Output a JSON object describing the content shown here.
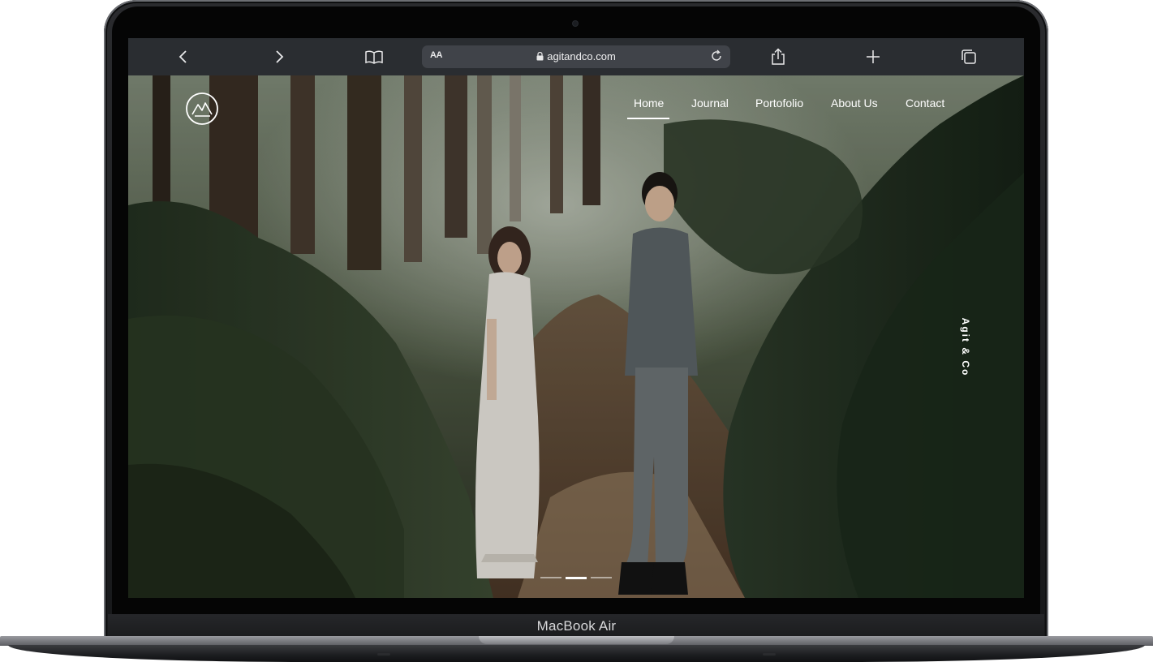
{
  "device": {
    "model_label": "MacBook Air"
  },
  "browser": {
    "text_size_label": "AA",
    "url": "agitandco.com",
    "icons": {
      "back": "chevron-left-icon",
      "forward": "chevron-right-icon",
      "bookmarks": "book-icon",
      "lock": "lock-icon",
      "reload": "reload-icon",
      "share": "share-icon",
      "new_tab": "plus-icon",
      "tabs": "tabs-icon"
    }
  },
  "site": {
    "logo": "mountain-logo-icon",
    "nav": [
      {
        "label": "Home",
        "active": true
      },
      {
        "label": "Journal",
        "active": false
      },
      {
        "label": "Portofolio",
        "active": false
      },
      {
        "label": "About Us",
        "active": false
      },
      {
        "label": "Contact",
        "active": false
      }
    ],
    "vertical_brand": "Agit & Co",
    "slider": {
      "slides": 3,
      "active_index": 1
    },
    "hero_image": "couple-in-forest-path-photo"
  },
  "colors": {
    "toolbar_bg": "#2a2d31",
    "address_bg": "#404349",
    "nav_text": "#ffffff",
    "bezel": "#050505"
  }
}
